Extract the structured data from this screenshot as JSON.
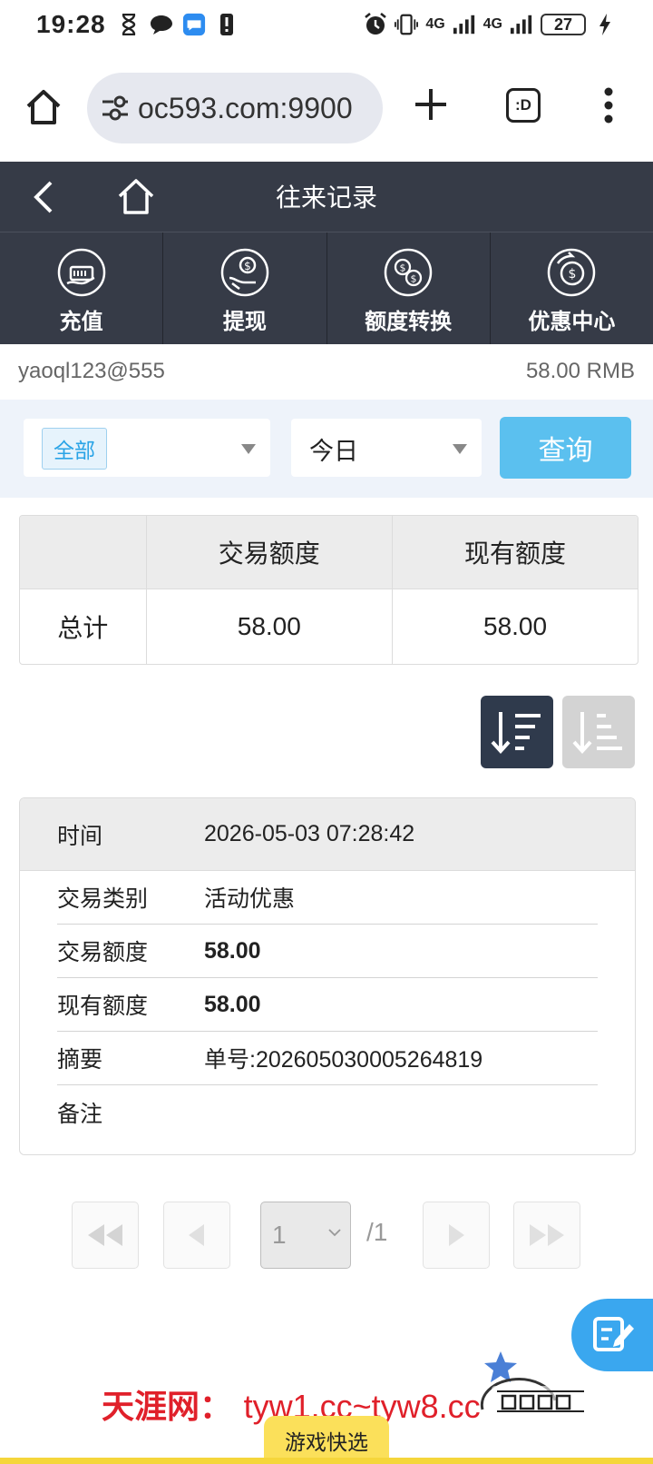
{
  "status_bar": {
    "time": "19:28",
    "network_1": "4G",
    "network_2": "4G",
    "battery": "27"
  },
  "browser": {
    "url": "oc593.com:9900",
    "tabs_label": ":D"
  },
  "header": {
    "title": "往来记录"
  },
  "quick_nav": [
    {
      "label": "充值",
      "icon": "deposit-icon"
    },
    {
      "label": "提现",
      "icon": "withdraw-icon"
    },
    {
      "label": "额度转换",
      "icon": "transfer-icon"
    },
    {
      "label": "优惠中心",
      "icon": "promo-icon"
    }
  ],
  "account": {
    "username": "yaoql123@555",
    "balance": "58.00 RMB"
  },
  "filters": {
    "type_value": "全部",
    "period_value": "今日",
    "query_label": "查询"
  },
  "summary": {
    "headers": [
      "",
      "交易额度",
      "现有额度"
    ],
    "row_label": "总计",
    "transaction_amount": "58.00",
    "current_amount": "58.00"
  },
  "record": {
    "time_label": "时间",
    "time_value": "2026-05-03 07:28:42",
    "rows": [
      {
        "label": "交易类别",
        "value": "活动优惠"
      },
      {
        "label": "交易额度",
        "value": "58.00"
      },
      {
        "label": "现有额度",
        "value": "58.00"
      },
      {
        "label": "摘要",
        "value": "单号:202605030005264819"
      },
      {
        "label": "备注",
        "value": ""
      }
    ]
  },
  "pager": {
    "current_page": "1",
    "total": "/1"
  },
  "footer": {
    "watermark_name": "天涯网：",
    "watermark_url": "tyw1.cc~tyw8.cc",
    "game_tab": "游戏快选"
  },
  "colors": {
    "header_bg": "#363b47",
    "query_button": "#5bc0ef",
    "sort_active": "#2f3a4c",
    "fab": "#3aa7ef",
    "game_tab": "#fbe05a"
  }
}
